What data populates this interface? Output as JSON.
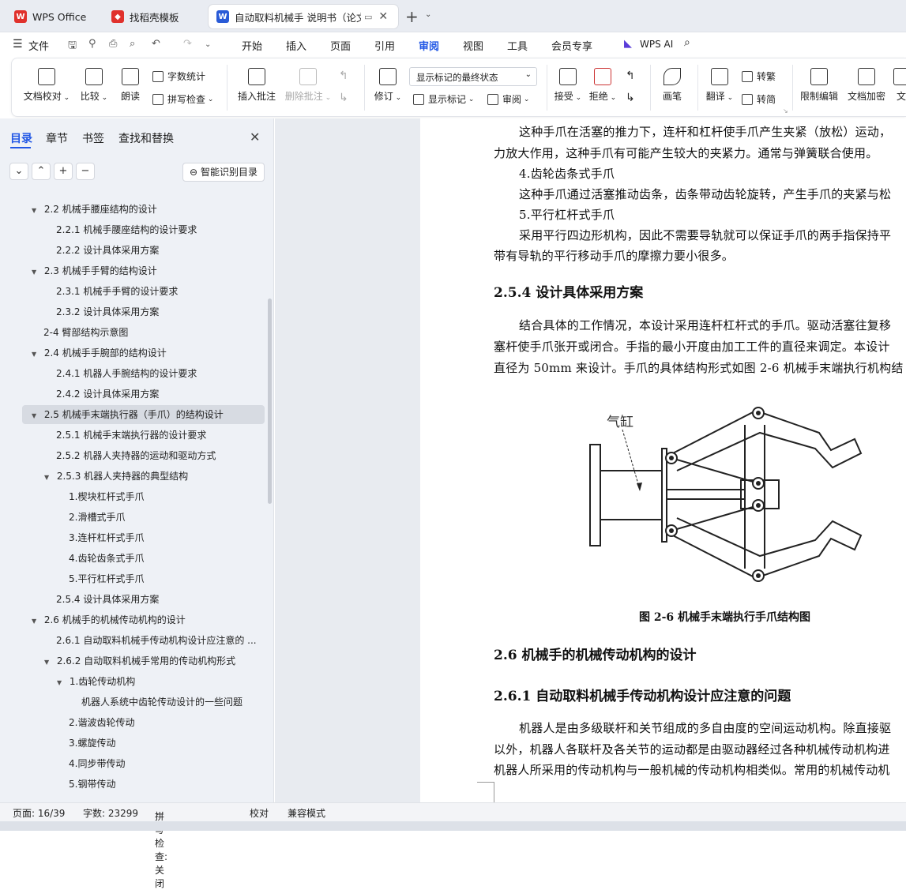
{
  "tabs": [
    {
      "label": "WPS Office",
      "color": "#e0312c"
    },
    {
      "label": "找稻壳模板",
      "color": "#e0312c"
    },
    {
      "label": "自动取料机械手 说明书（论文",
      "color": "#2a5bd7"
    }
  ],
  "menu": {
    "file": "文件",
    "items": [
      "开始",
      "插入",
      "页面",
      "引用",
      "审阅",
      "视图",
      "工具",
      "会员专享"
    ],
    "active": "审阅",
    "ai": "WPS AI"
  },
  "ribbon": {
    "doc_check": "文档校对",
    "compare": "比较",
    "read": "朗读",
    "word_count": "字数统计",
    "spell_check": "拼写检查",
    "insert_comment": "插入批注",
    "delete_comment": "删除批注",
    "revise": "修订",
    "display_state": "显示标记的最终状态",
    "show_markup": "显示标记",
    "review": "审阅",
    "accept": "接受",
    "reject": "拒绝",
    "pen": "画笔",
    "translate": "翻译",
    "trad_to_simp": "转繁",
    "simp": "转简",
    "restrict": "限制编辑",
    "encrypt": "文档加密",
    "more": "文"
  },
  "panel": {
    "tabs": [
      "目录",
      "章节",
      "书签",
      "查找和替换"
    ],
    "smart_btn": "智能识别目录",
    "toc": [
      {
        "text": "2.2 机械手腰座结构的设计",
        "level": 1,
        "expand": "▼"
      },
      {
        "text": "2.2.1 机械手腰座结构的设计要求",
        "level": 2,
        "expand": ""
      },
      {
        "text": "2.2.2 设计具体采用方案",
        "level": 2,
        "expand": ""
      },
      {
        "text": "2.3 机械手手臂的结构设计",
        "level": 1,
        "expand": "▼"
      },
      {
        "text": "2.3.1 机械手手臂的设计要求",
        "level": 2,
        "expand": ""
      },
      {
        "text": "2.3.2 设计具体采用方案",
        "level": 2,
        "expand": ""
      },
      {
        "text": "2-4 臂部结构示意图",
        "level": 1,
        "expand": ""
      },
      {
        "text": "2.4 机械手手腕部的结构设计",
        "level": 1,
        "expand": "▼"
      },
      {
        "text": "2.4.1 机器人手腕结构的设计要求",
        "level": 2,
        "expand": ""
      },
      {
        "text": "2.4.2 设计具体采用方案",
        "level": 2,
        "expand": ""
      },
      {
        "text": "2.5 机械手末端执行器（手爪）的结构设计",
        "level": 1,
        "expand": "▼",
        "selected": true
      },
      {
        "text": "2.5.1 机械手末端执行器的设计要求",
        "level": 2,
        "expand": ""
      },
      {
        "text": "2.5.2 机器人夹持器的运动和驱动方式",
        "level": 2,
        "expand": ""
      },
      {
        "text": "2.5.3 机器人夹持器的典型结构",
        "level": 2,
        "expand": "▼"
      },
      {
        "text": "1.楔块杠杆式手爪",
        "level": 3,
        "expand": ""
      },
      {
        "text": "2.滑槽式手爪",
        "level": 3,
        "expand": ""
      },
      {
        "text": "3.连杆杠杆式手爪",
        "level": 3,
        "expand": ""
      },
      {
        "text": "4.齿轮齿条式手爪",
        "level": 3,
        "expand": ""
      },
      {
        "text": "5.平行杠杆式手爪",
        "level": 3,
        "expand": ""
      },
      {
        "text": "2.5.4 设计具体采用方案",
        "level": 2,
        "expand": ""
      },
      {
        "text": "2.6 机械手的机械传动机构的设计",
        "level": 1,
        "expand": "▼"
      },
      {
        "text": "2.6.1 自动取料机械手传动机构设计应注意的 ...",
        "level": 2,
        "expand": ""
      },
      {
        "text": "2.6.2 自动取料机械手常用的传动机构形式",
        "level": 2,
        "expand": "▼"
      },
      {
        "text": "1.齿轮传动机构",
        "level": 3,
        "expand": "▼"
      },
      {
        "text": "机器人系统中齿轮传动设计的一些问题",
        "level": 4,
        "expand": ""
      },
      {
        "text": "2.谐波齿轮传动",
        "level": 3,
        "expand": ""
      },
      {
        "text": "3.螺旋传动",
        "level": 3,
        "expand": ""
      },
      {
        "text": "4.同步带传动",
        "level": 3,
        "expand": ""
      },
      {
        "text": "5.钢带传动",
        "level": 3,
        "expand": ""
      }
    ]
  },
  "doc": {
    "lines": [
      "这种手爪在活塞的推力下，连杆和杠杆使手爪产生夹紧（放松）运动，",
      "力放大作用，这种手爪有可能产生较大的夹紧力。通常与弹簧联合使用。",
      "4.齿轮齿条式手爪",
      "这种手爪通过活塞推动齿条，齿条带动齿轮旋转，产生手爪的夹紧与松",
      "5.平行杠杆式手爪",
      "采用平行四边形机构，因此不需要导轨就可以保证手爪的两手指保持平",
      "带有导轨的平行移动手爪的摩擦力要小很多。"
    ],
    "h254": "2.5.4 设计具体采用方案",
    "para2": [
      "结合具体的工作情况，本设计采用连杆杠杆式的手爪。驱动活塞往复移",
      "塞杆使手爪张开或闭合。手指的最小开度由加工工件的直径来调定。本设计",
      "直径为 50mm 来设计。手爪的具体结构形式如图 2-6 机械手末端执行机构结"
    ],
    "fig_label": "气缸",
    "fig_caption": "图 2-6 机械手末端执行手爪结构图",
    "h26": "2.6 机械手的机械传动机构的设计",
    "h261": "2.6.1 自动取料机械手传动机构设计应注意的问题",
    "para3": [
      "机器人是由多级联杆和关节组成的多自由度的空间运动机构。除直接驱",
      "以外，机器人各联杆及各关节的运动都是由驱动器经过各种机械传动机构进",
      "机器人所采用的传动机构与一般机械的传动机构相类似。常用的机械传动机"
    ]
  },
  "status": {
    "page": "页面: 16/39",
    "words": "字数: 23299",
    "spell": "拼写检查: 关闭",
    "proof": "校对",
    "compat": "兼容模式"
  }
}
